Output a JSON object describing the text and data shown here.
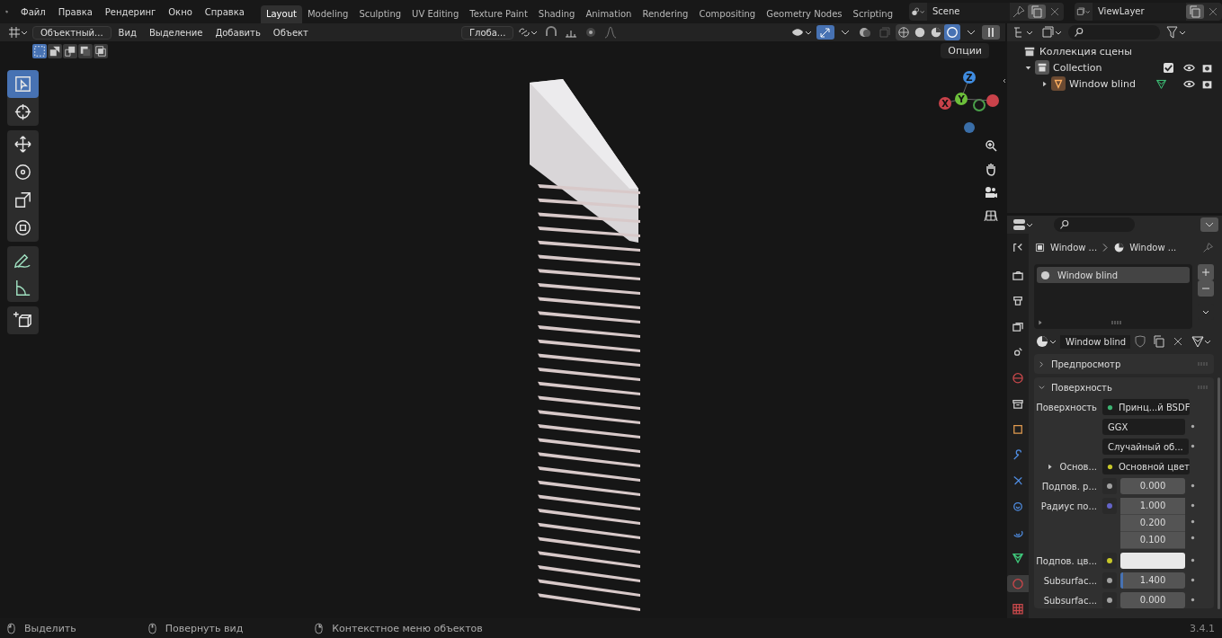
{
  "menu": [
    "Файл",
    "Правка",
    "Рендеринг",
    "Окно",
    "Справка"
  ],
  "workspaces": [
    {
      "label": "Layout",
      "selected": true
    },
    {
      "label": "Modeling",
      "selected": false
    },
    {
      "label": "Sculpting",
      "selected": false
    },
    {
      "label": "UV Editing",
      "selected": false
    },
    {
      "label": "Texture Paint",
      "selected": false
    },
    {
      "label": "Shading",
      "selected": false
    },
    {
      "label": "Animation",
      "selected": false
    },
    {
      "label": "Rendering",
      "selected": false
    },
    {
      "label": "Compositing",
      "selected": false
    },
    {
      "label": "Geometry Nodes",
      "selected": false
    },
    {
      "label": "Scripting",
      "selected": false
    }
  ],
  "scene": "Scene",
  "view_layer": "ViewLayer",
  "viewport_header": {
    "mode": "Объектный...",
    "menus": [
      "Вид",
      "Выделение",
      "Добавить",
      "Объект"
    ],
    "orientation": "Глоба...",
    "options": "Опции",
    "shading": [
      {
        "kind": "wireframe",
        "selected": false
      },
      {
        "kind": "solid",
        "selected": false
      },
      {
        "kind": "material",
        "selected": false
      },
      {
        "kind": "rendered",
        "selected": true
      }
    ]
  },
  "tool_groups": [
    {
      "tools": [
        {
          "kind": "select",
          "selected": true
        },
        {
          "kind": "cursor",
          "selected": false
        }
      ]
    },
    {
      "tools": [
        {
          "kind": "move",
          "selected": false
        },
        {
          "kind": "rotate",
          "selected": false
        },
        {
          "kind": "scale",
          "selected": false
        },
        {
          "kind": "transform",
          "selected": false
        }
      ]
    },
    {
      "tools": [
        {
          "kind": "annotate",
          "selected": false
        },
        {
          "kind": "measure",
          "selected": false
        }
      ]
    },
    {
      "tools": [
        {
          "kind": "add_cube",
          "selected": false
        }
      ]
    }
  ],
  "gizmo": {
    "z": "Z",
    "y": "Y",
    "x": "X"
  },
  "outliner": {
    "root": "Коллекция сцены",
    "items": [
      {
        "label": "Collection",
        "expanded": true,
        "checked": true,
        "children": [
          {
            "label": "Window blind",
            "expanded": false
          }
        ]
      }
    ]
  },
  "properties": {
    "breadcrumb": [
      "Window ...",
      "Window ..."
    ],
    "slots": [
      {
        "label": "Window blind",
        "selected": true
      }
    ],
    "material": "Window blind",
    "tabs": [
      {
        "kind": "tool",
        "selected": false
      },
      {
        "kind": "render",
        "selected": false
      },
      {
        "kind": "output",
        "selected": false
      },
      {
        "kind": "view_layer",
        "selected": false
      },
      {
        "kind": "scene",
        "selected": false
      },
      {
        "kind": "world",
        "selected": false
      },
      {
        "kind": "collection",
        "selected": false
      },
      {
        "kind": "object",
        "selected": false
      },
      {
        "kind": "modifiers",
        "selected": false
      },
      {
        "kind": "particles",
        "selected": false
      },
      {
        "kind": "physics",
        "selected": false
      },
      {
        "kind": "constraints",
        "selected": false
      },
      {
        "kind": "data",
        "selected": false
      },
      {
        "kind": "material",
        "selected": true
      },
      {
        "kind": "texture",
        "selected": false
      }
    ],
    "panels": [
      {
        "title": "Предпросмотр",
        "expanded": false
      },
      {
        "title": "Поверхность",
        "expanded": true
      }
    ],
    "rows": [
      {
        "kind": "link",
        "label": "Поверхность",
        "color": "#3cb371",
        "value": "Принц...й BSDF"
      },
      {
        "kind": "dropdown",
        "value": "GGX"
      },
      {
        "kind": "dropdown",
        "value": "Случайный об..."
      },
      {
        "kind": "link",
        "label": "Основ...",
        "color": "#c7c729",
        "value": "Основной цвет",
        "expanded": false
      },
      {
        "kind": "number",
        "label": "Подпов. р...",
        "color": "#a1a1a1",
        "values": [
          "0.000"
        ]
      },
      {
        "kind": "number",
        "label": "Радиус по...",
        "color": "#6363c7",
        "values": [
          "1.000",
          "0.200",
          "0.100"
        ]
      },
      {
        "kind": "swatch",
        "label": "Подпов. цв...",
        "color": "#c7c729"
      },
      {
        "kind": "slider",
        "label": "Subsurfac...",
        "color": "#a1a1a1",
        "value": "1.400",
        "level": 0.04
      },
      {
        "kind": "number",
        "label": "Subsurfac...",
        "color": "#a1a1a1",
        "values": [
          "0.000"
        ]
      }
    ]
  },
  "status": [
    "Выделить",
    "Повернуть вид",
    "Контекстное меню объектов"
  ],
  "version": "3.4.1"
}
